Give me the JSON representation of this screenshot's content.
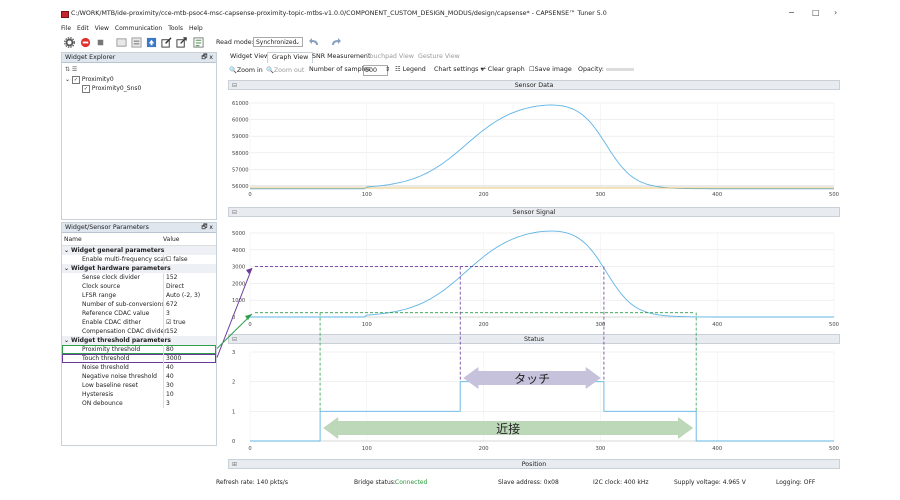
{
  "window": {
    "title": "C:/WORK/MTB/ide-proximity/cce-mtb-psoc4-msc-capsense-proximity-topic-mtbs-v1.0.0/COMPONENT_CUSTOM_DESIGN_MODUS/design/capsense* - CAPSENSE™ Tuner 5.0",
    "min": "−",
    "max": "□",
    "close": "›"
  },
  "menu": [
    "File",
    "Edit",
    "View",
    "Communication",
    "Tools",
    "Help"
  ],
  "toolbar": {
    "read_mode_label": "Read mode:",
    "read_mode_value": "Synchronized",
    "icons": [
      "gear-icon",
      "stop-icon",
      "square-icon",
      "box-icon",
      "list-icon",
      "upload-icon",
      "edit-icon",
      "export-icon",
      "log-icon"
    ],
    "accent": "#3b78c8",
    "stop_color": "#e03030"
  },
  "widget_explorer": {
    "title": "Widget Explorer",
    "tree": [
      {
        "label": "Proximity0",
        "checked": true,
        "level": 0
      },
      {
        "label": "Proximity0_Sns0",
        "checked": true,
        "level": 1
      }
    ]
  },
  "params": {
    "title": "Widget/Sensor Parameters",
    "col_name": "Name",
    "col_value": "Value",
    "rows": [
      {
        "group": true,
        "name": "Widget general parameters"
      },
      {
        "name": "Enable multi-frequency scan",
        "value": "false",
        "checkbox": true
      },
      {
        "group": true,
        "name": "Widget hardware parameters"
      },
      {
        "name": "Sense clock divider",
        "value": "152"
      },
      {
        "name": "Clock source",
        "value": "Direct"
      },
      {
        "name": "LFSR range",
        "value": "Auto (-2, 3)"
      },
      {
        "name": "Number of sub-conversions",
        "value": "672"
      },
      {
        "name": "Reference CDAC value",
        "value": "3"
      },
      {
        "name": "Enable CDAC dither",
        "value": "true",
        "checkbox": true
      },
      {
        "name": "Compensation CDAC divider",
        "value": "152"
      },
      {
        "group": true,
        "name": "Widget threshold parameters"
      },
      {
        "name": "Proximity threshold",
        "value": "80",
        "highlight": "#2f9e4a"
      },
      {
        "name": "Touch threshold",
        "value": "3000",
        "highlight": "#6a3a9a"
      },
      {
        "name": "Noise threshold",
        "value": "40"
      },
      {
        "name": "Negative noise threshold",
        "value": "40"
      },
      {
        "name": "Low baseline reset",
        "value": "30"
      },
      {
        "name": "Hysteresis",
        "value": "10"
      },
      {
        "name": "ON debounce",
        "value": "3"
      }
    ]
  },
  "tabs": [
    "Widget View",
    "Graph View",
    "SNR Measurement",
    "Touchpad View",
    "Gesture View"
  ],
  "graph_toolbar": {
    "zoom_in": "Zoom in",
    "zoom_out": "Zoom out",
    "samples_label": "Number of samples",
    "samples_value": "500",
    "legend": "Legend",
    "chart_settings": "Chart settings",
    "clear_graph": "Clear graph",
    "save_image": "Save image",
    "opacity": "Opacity:"
  },
  "charts": {
    "sensor_data": {
      "title": "Sensor Data",
      "yticks": [
        "61000",
        "60000",
        "59000",
        "58000",
        "57000",
        "56000"
      ]
    },
    "sensor_signal": {
      "title": "Sensor Signal",
      "yticks": [
        "5000",
        "4000",
        "3000",
        "2000",
        "1000",
        "0"
      ]
    },
    "status": {
      "title": "Status",
      "yticks": [
        "3",
        "2",
        "1",
        "0"
      ]
    },
    "position": {
      "title": "Position"
    },
    "xticks": [
      "0",
      "100",
      "200",
      "300",
      "400",
      "500"
    ],
    "line_color": "#5fb4e6",
    "baseline_color": "#e0b040",
    "touch_color": "#6a3a9a",
    "proximity_color": "#2f9e4a"
  },
  "annotations": {
    "touch_label": "タッチ",
    "proximity_label": "近接"
  },
  "status_bar": {
    "refresh_rate": "Refresh rate:  140 pkts/s",
    "bridge_label": "Bridge status:",
    "bridge_value": "Connected",
    "slave": "Slave address:  0x08",
    "i2c": "I2C clock:  400 kHz",
    "voltage": "Supply voltage:  4.965 V",
    "logging": "Logging:  OFF"
  }
}
